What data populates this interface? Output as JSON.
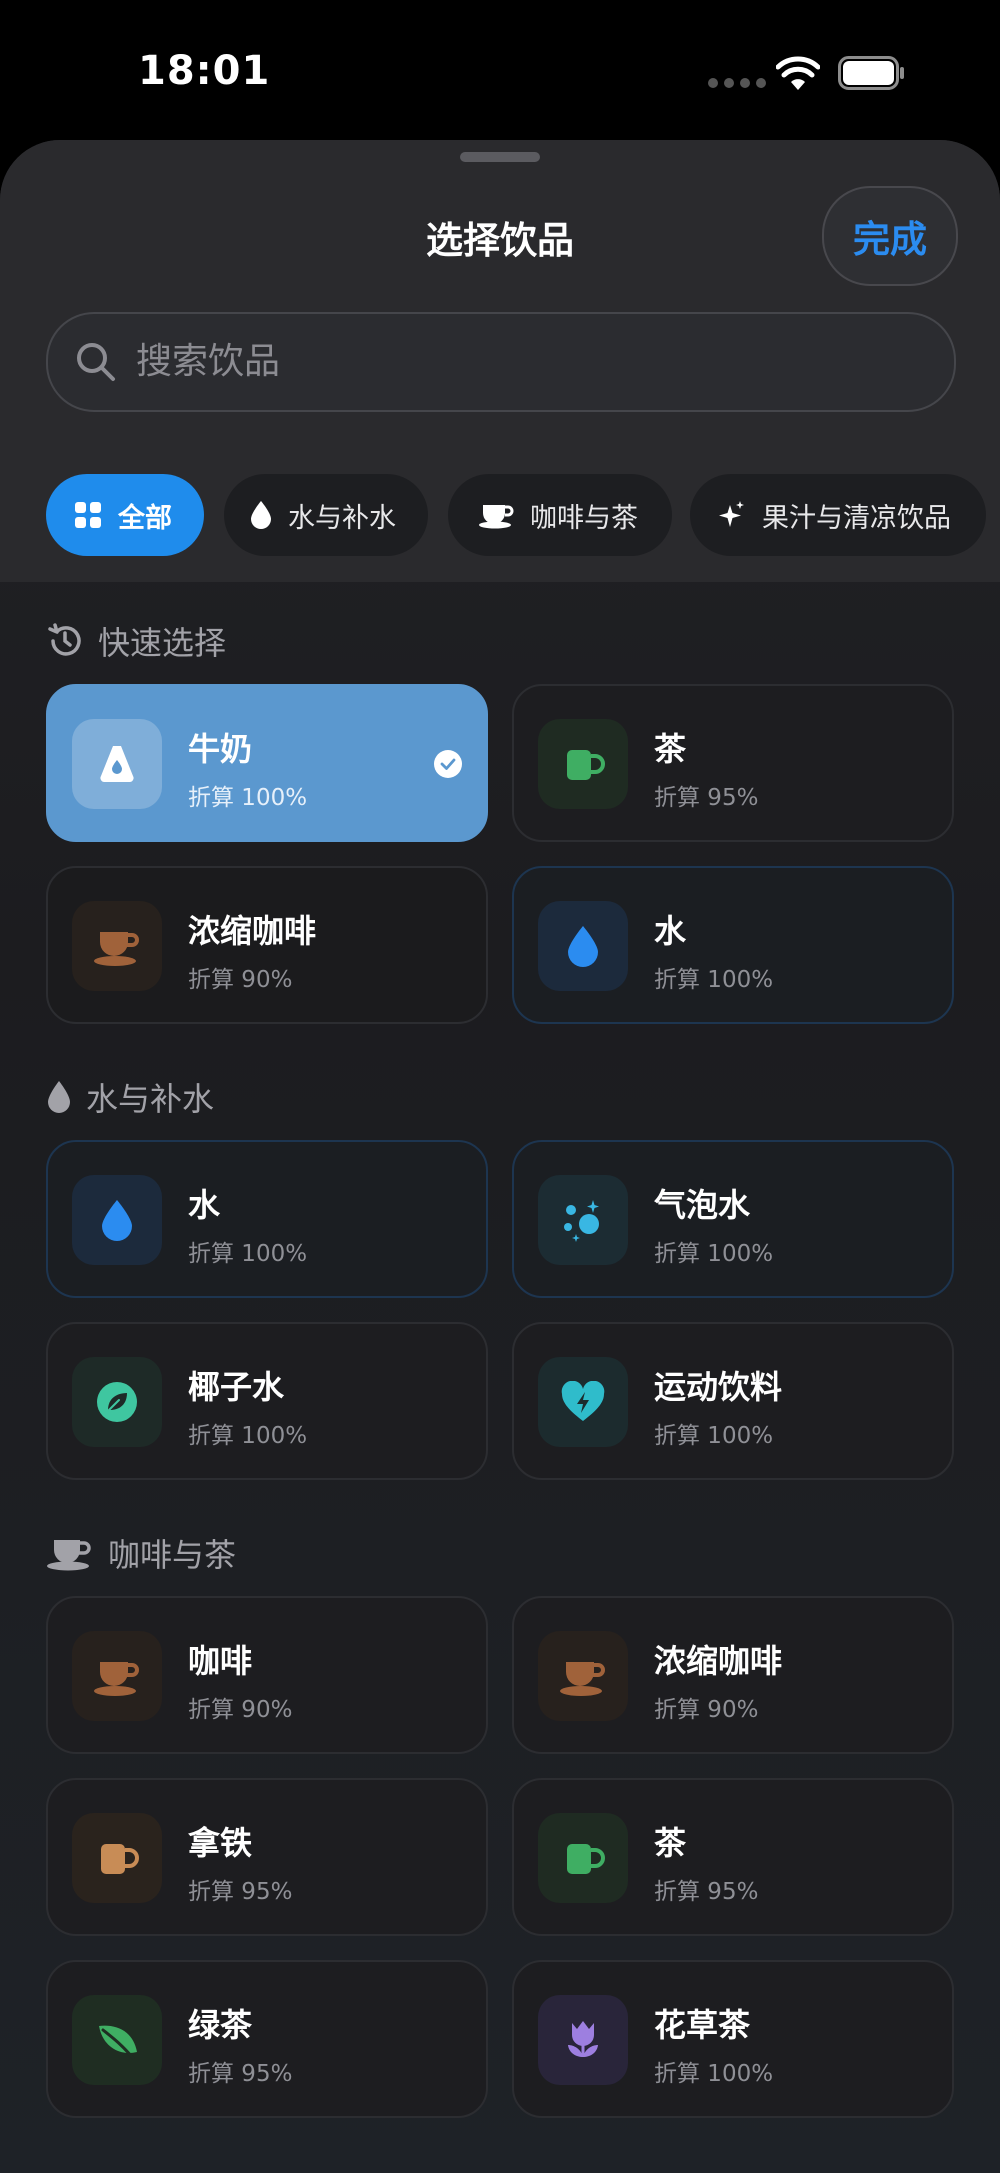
{
  "status_bar": {
    "time": "18:01"
  },
  "sheet": {
    "title": "选择饮品",
    "done_label": "完成",
    "search_placeholder": "搜索饮品"
  },
  "categories": [
    {
      "label": "全部",
      "icon": "grid-icon",
      "active": true
    },
    {
      "label": "水与补水",
      "icon": "drop-icon",
      "active": false
    },
    {
      "label": "咖啡与茶",
      "icon": "coffee-cup-icon",
      "active": false
    },
    {
      "label": "果汁与清凉饮品",
      "icon": "sparkles-icon",
      "active": false
    }
  ],
  "sections": [
    {
      "title": "快速选择",
      "icon": "history-icon",
      "items": [
        {
          "name": "牛奶",
          "ratio": "折算 100%",
          "icon": "milk-icon",
          "selected": true
        },
        {
          "name": "茶",
          "ratio": "折算 95%",
          "icon": "mug-icon",
          "selected": false
        },
        {
          "name": "浓缩咖啡",
          "ratio": "折算 90%",
          "icon": "coffee-icon",
          "selected": false
        },
        {
          "name": "水",
          "ratio": "折算 100%",
          "icon": "water-drop-icon",
          "selected": false
        }
      ]
    },
    {
      "title": "水与补水",
      "icon": "drop-icon",
      "items": [
        {
          "name": "水",
          "ratio": "折算 100%",
          "icon": "water-drop-icon",
          "selected": false
        },
        {
          "name": "气泡水",
          "ratio": "折算 100%",
          "icon": "bubbles-icon",
          "selected": false
        },
        {
          "name": "椰子水",
          "ratio": "折算 100%",
          "icon": "leaf-circle-icon",
          "selected": false
        },
        {
          "name": "运动饮料",
          "ratio": "折算 100%",
          "icon": "heart-bolt-icon",
          "selected": false
        }
      ]
    },
    {
      "title": "咖啡与茶",
      "icon": "coffee-cup-icon",
      "items": [
        {
          "name": "咖啡",
          "ratio": "折算 90%",
          "icon": "coffee-icon",
          "selected": false
        },
        {
          "name": "浓缩咖啡",
          "ratio": "折算 90%",
          "icon": "coffee-icon",
          "selected": false
        },
        {
          "name": "拿铁",
          "ratio": "折算 95%",
          "icon": "latte-mug-icon",
          "selected": false
        },
        {
          "name": "茶",
          "ratio": "折算 95%",
          "icon": "mug-icon",
          "selected": false
        },
        {
          "name": "绿茶",
          "ratio": "折算 95%",
          "icon": "leaf-icon",
          "selected": false
        },
        {
          "name": "花草茶",
          "ratio": "折算 100%",
          "icon": "tulip-icon",
          "selected": false
        }
      ]
    }
  ],
  "colors": {
    "accent": "#2b8cf0",
    "chip_active": "#1f8cec",
    "selected_card": "#5b98cf",
    "water": "#2b8cf0",
    "tea_green": "#3fae63",
    "coffee_brown": "#a0623a",
    "latte": "#c88c56",
    "mint": "#3fc6a0",
    "flower_purple": "#9d7fe0"
  }
}
